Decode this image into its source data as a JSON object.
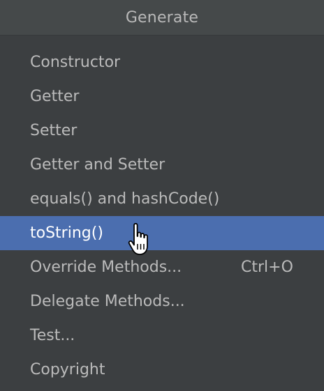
{
  "header": {
    "title": "Generate"
  },
  "menu": {
    "items": [
      {
        "label": "Constructor",
        "shortcut": ""
      },
      {
        "label": "Getter",
        "shortcut": ""
      },
      {
        "label": "Setter",
        "shortcut": ""
      },
      {
        "label": "Getter and Setter",
        "shortcut": ""
      },
      {
        "label": "equals() and hashCode()",
        "shortcut": ""
      },
      {
        "label": "toString()",
        "shortcut": "",
        "selected": true
      },
      {
        "label": "Override Methods...",
        "shortcut": "Ctrl+O"
      },
      {
        "label": "Delegate Methods...",
        "shortcut": ""
      },
      {
        "label": "Test...",
        "shortcut": ""
      },
      {
        "label": "Copyright",
        "shortcut": ""
      }
    ]
  },
  "colors": {
    "background": "#3c3f41",
    "header_background": "#45494a",
    "text": "#bbbbbb",
    "selection": "#4b6eaf",
    "selected_text": "#ffffff"
  },
  "icons": {
    "cursor": "hand-pointer-icon"
  }
}
